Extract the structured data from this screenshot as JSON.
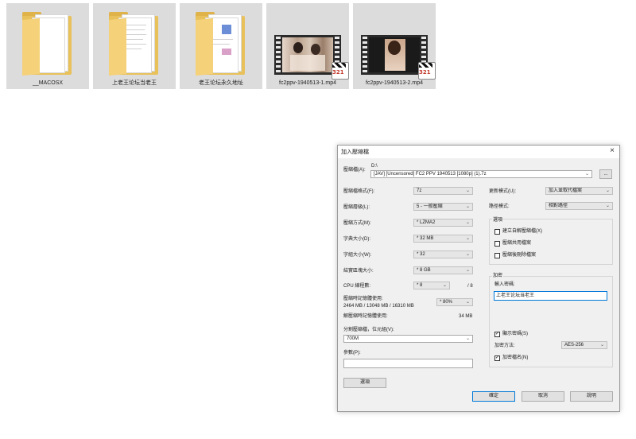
{
  "files": [
    {
      "name": "__MACOSX",
      "type": "folder"
    },
    {
      "name": "上老王论坛当老王",
      "type": "folder"
    },
    {
      "name": "老王论坛永久地址",
      "type": "folder"
    },
    {
      "name": "fc2ppv-1940513-1.mp4",
      "type": "video"
    },
    {
      "name": "fc2ppv-1940513-2.mp4",
      "type": "video"
    }
  ],
  "dialog": {
    "title": "加入壓縮檔",
    "close_icon": "×",
    "archive_label": "壓縮檔(A):",
    "archive_dir": "D:\\",
    "archive_path": "[JAV] [Uncensored] FC2 PPV 1940513 [1080p] (1).7z",
    "browse_label": "...",
    "format_label": "壓縮檔格式(F):",
    "format_value": "7z",
    "level_label": "壓縮層級(L):",
    "level_value": "5 - 一般壓縮",
    "method_label": "壓縮方式(M):",
    "method_value": "* LZMA2",
    "dict_label": "字典大小(D):",
    "dict_value": "* 32 MB",
    "word_label": "字組大小(W):",
    "word_value": "* 32",
    "solid_label": "結實區塊大小:",
    "solid_value": "* 8 GB",
    "cpu_label": "CPU 線程數:",
    "cpu_value": "* 8",
    "cpu_total": "/ 8",
    "mem_label": "壓縮時記憶體使用:",
    "mem_values": "2464 MB / 13048 MB / 16310 MB",
    "mem_percent": "* 80%",
    "decomp_label": "解壓縮時記憶體使用:",
    "decomp_value": "34 MB",
    "split_label": "分割壓縮檔，位元組(V):",
    "split_value": "700M",
    "params_label": "參數(P):",
    "params_value": "",
    "options_button": "選項",
    "update_label": "更新模式(U):",
    "update_value": "加入並取代檔案",
    "path_label": "路徑模式:",
    "path_value": "相對路徑",
    "options_group": "選項",
    "opt_sfx": "建立自解壓縮檔(X)",
    "opt_shared": "壓縮共用檔案",
    "opt_delete": "壓縮後刪除檔案",
    "encrypt_group": "加密",
    "password_label": "輸入密碼:",
    "password_value": "上老王论坛当老王",
    "show_password": "顯示密碼(S)",
    "encrypt_method_label": "加密方法:",
    "encrypt_method_value": "AES-256",
    "encrypt_names": "加密檔名(N)",
    "ok_button": "確定",
    "cancel_button": "取消",
    "help_button": "說明",
    "check_mark": "✓",
    "chevron": "⌄"
  }
}
